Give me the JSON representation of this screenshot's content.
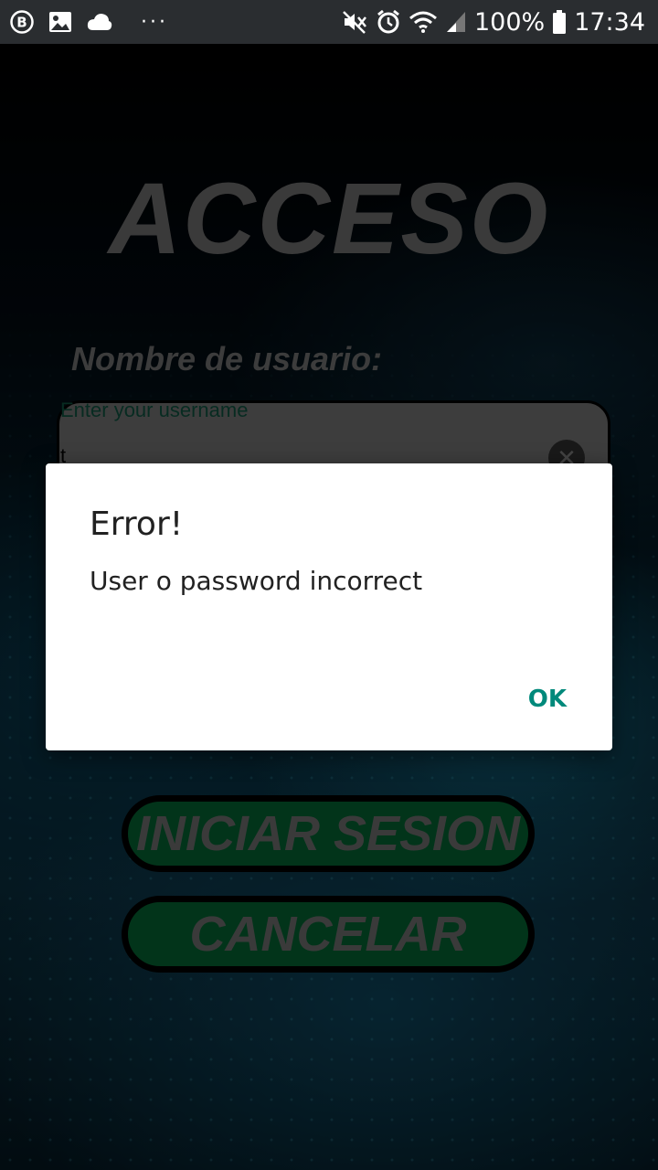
{
  "status_bar": {
    "battery": "100%",
    "time": "17:34",
    "more": "···",
    "icons": [
      "b-circle-icon",
      "image-icon",
      "cloud-icon",
      "mute-icon",
      "alarm-icon",
      "wifi-icon",
      "signal-icon",
      "battery-icon"
    ]
  },
  "login": {
    "title": "ACCESO",
    "username_label": "Nombre de usuario:",
    "username_placeholder": "Enter your username",
    "username_value": "t",
    "login_button": "INICIAR SESION",
    "cancel_button": "CANCELAR"
  },
  "dialog": {
    "title": "Error!",
    "message": "User o password incorrect",
    "ok": "OK"
  },
  "colors": {
    "accent": "#00897b",
    "button_green": "#056030",
    "status_bar": "#2a2d30"
  }
}
